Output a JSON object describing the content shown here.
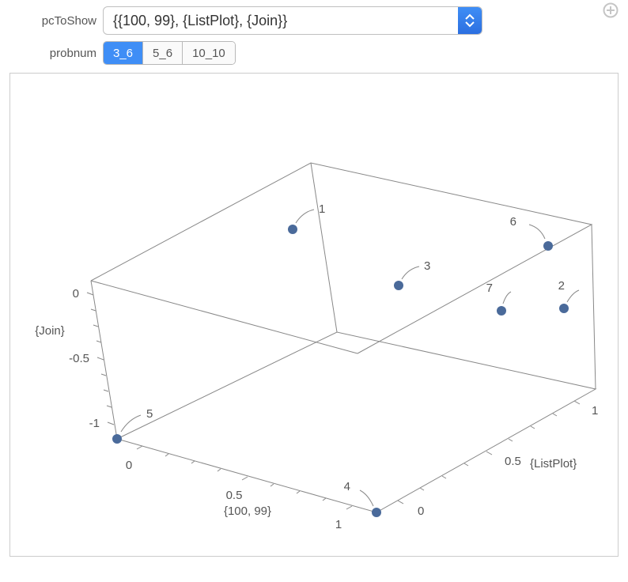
{
  "controls": {
    "pcToShow": {
      "label": "pcToShow",
      "value": "{{100, 99}, {ListPlot}, {Join}}"
    },
    "probnum": {
      "label": "probnum",
      "options": [
        "3_6",
        "5_6",
        "10_10"
      ],
      "selected": "3_6"
    },
    "plusIcon": "plus"
  },
  "chart_data": {
    "type": "scatter",
    "space": "3d",
    "axes": {
      "x": {
        "label": "{100, 99}",
        "ticks": [
          0.0,
          0.5,
          1.0
        ],
        "range": [
          -0.1,
          1.1
        ]
      },
      "y": {
        "label": "{ListPlot}",
        "ticks": [
          0.0,
          0.5,
          1.0
        ],
        "range": [
          -0.1,
          1.1
        ]
      },
      "z": {
        "label": "{Join}",
        "ticks": [
          0.0,
          -0.5,
          -1.0
        ],
        "range": [
          -1.1,
          0.1
        ]
      }
    },
    "points": [
      {
        "id": "1",
        "x": 0.0,
        "y": 1.0,
        "z": 0.0
      },
      {
        "id": "2",
        "x": 1.0,
        "y": 1.0,
        "z": -0.35
      },
      {
        "id": "3",
        "x": 0.55,
        "y": 1.0,
        "z": -0.2
      },
      {
        "id": "4",
        "x": 1.0,
        "y": 0.0,
        "z": -1.0
      },
      {
        "id": "5",
        "x": 0.0,
        "y": 0.0,
        "z": -1.0
      },
      {
        "id": "6",
        "x": 1.0,
        "y": 1.0,
        "z": 0.0
      },
      {
        "id": "7",
        "x": 0.85,
        "y": 1.0,
        "z": -0.35
      }
    ]
  }
}
